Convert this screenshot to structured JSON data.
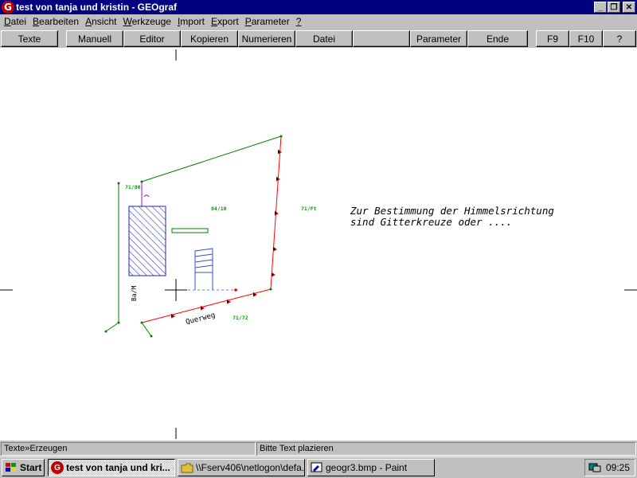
{
  "window": {
    "title": "test von tanja und kristin - GEOgraf",
    "app_icon_letter": "G",
    "controls": [
      "_",
      "❐",
      "✕"
    ]
  },
  "menu": [
    {
      "label": "Datei"
    },
    {
      "label": "Bearbeiten"
    },
    {
      "label": "Ansicht"
    },
    {
      "label": "Werkzeuge"
    },
    {
      "label": "Import"
    },
    {
      "label": "Export"
    },
    {
      "label": "Parameter"
    },
    {
      "label": "?"
    }
  ],
  "toolbar": [
    {
      "label": "Texte"
    },
    {
      "label": "Manuell"
    },
    {
      "label": "Editor"
    },
    {
      "label": "Kopieren"
    },
    {
      "label": "Numerieren"
    },
    {
      "label": "Datei"
    },
    {
      "label": ""
    },
    {
      "label": "Parameter"
    },
    {
      "label": "Ende"
    },
    {
      "label": "F9"
    },
    {
      "label": "F10"
    },
    {
      "label": "?"
    }
  ],
  "drawing": {
    "note_line1": "Zur Bestimmung der Himmelsrichtung",
    "note_line2": "sind Gitterkreuze oder ....",
    "street_label": "Querweg",
    "building_label": "Ba/M",
    "parcel_labels": [
      "71/80",
      "84/10",
      "71/Ft",
      "71/72"
    ],
    "colors": {
      "parcel_boundary": "#ff0000",
      "boundary_green": "#008000",
      "building": "#0000c0",
      "label_green": "#00a000"
    }
  },
  "status": {
    "left": "Texte»Erzeugen",
    "right": "Bitte Text plazieren"
  },
  "taskbar": {
    "start": "Start",
    "tasks": [
      {
        "label": "test von tanja und kri...",
        "icon": "geograf-icon",
        "active": true
      },
      {
        "label": "\\\\Fserv406\\netlogon\\defa...",
        "icon": "folder-icon",
        "active": false
      },
      {
        "label": "geogr3.bmp - Paint",
        "icon": "paint-icon",
        "active": false
      }
    ],
    "clock": "09:25"
  }
}
